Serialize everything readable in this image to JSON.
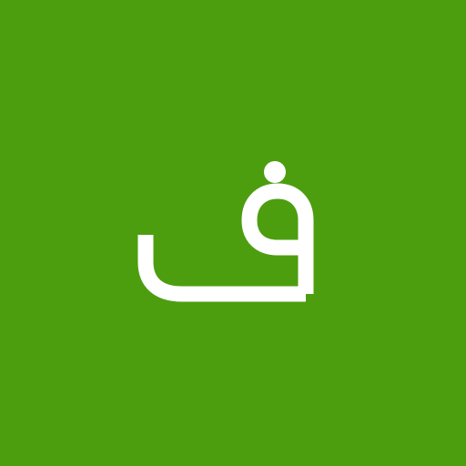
{
  "avatar": {
    "letter": "ف",
    "background_color": "#4c9e0f",
    "letter_color": "#ffffff"
  }
}
